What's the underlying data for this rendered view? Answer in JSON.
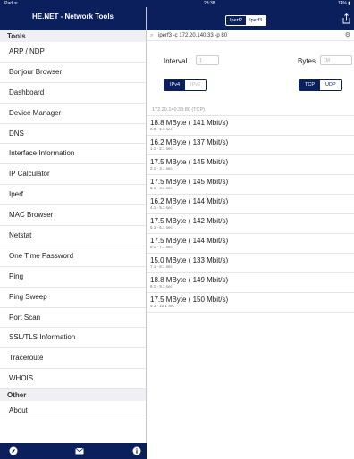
{
  "status_bar": {
    "carrier": "iPad ᯤ",
    "time": "23:38",
    "battery": "74% ▮"
  },
  "sidebar": {
    "title": "HE.NET - Network Tools",
    "sections": [
      {
        "header": "Tools",
        "items": [
          "ARP / NDP",
          "Bonjour Browser",
          "Dashboard",
          "Device Manager",
          "DNS",
          "Interface Information",
          "IP Calculator",
          "Iperf",
          "MAC Browser",
          "Netstat",
          "One Time Password",
          "Ping",
          "Ping Sweep",
          "Port Scan",
          "SSL/TLS Information",
          "Traceroute",
          "WHOIS"
        ]
      },
      {
        "header": "Other",
        "items": [
          "About"
        ]
      }
    ],
    "footer_icons": [
      "compass-icon",
      "mail-icon",
      "info-icon"
    ]
  },
  "main": {
    "segments": [
      "Iperf2",
      "Iperf3"
    ],
    "active_segment": "Iperf3",
    "command": "iperf3 -c 172.20.140.33 -p 80",
    "interval_label": "Interval",
    "interval_placeholder": "1",
    "bytes_label": "Bytes",
    "bytes_placeholder": "1M",
    "ip_options": [
      "IPv4",
      "IPv6"
    ],
    "ip_selected": "IPv4",
    "proto_options": [
      "TCP",
      "UDP"
    ],
    "proto_selected": "TCP",
    "target": "172.20.140.33:80 (TCP)",
    "results": [
      {
        "value": "18.8 MByte ( 141 Mbit/s)",
        "range": "0.0 - 1.1 sec"
      },
      {
        "value": "16.2 MByte ( 137 Mbit/s)",
        "range": "1.1 - 2.1 sec"
      },
      {
        "value": "17.5 MByte ( 145 Mbit/s)",
        "range": "2.1 - 3.1 sec"
      },
      {
        "value": "17.5 MByte ( 145 Mbit/s)",
        "range": "3.1 - 4.1 sec"
      },
      {
        "value": "16.2 MByte ( 144 Mbit/s)",
        "range": "4.1 - 5.1 sec"
      },
      {
        "value": "17.5 MByte ( 142 Mbit/s)",
        "range": "5.1 - 6.1 sec"
      },
      {
        "value": "17.5 MByte ( 144 Mbit/s)",
        "range": "6.1 - 7.1 sec"
      },
      {
        "value": "15.0 MByte ( 133 Mbit/s)",
        "range": "7.1 - 8.1 sec"
      },
      {
        "value": "18.8 MByte ( 149 Mbit/s)",
        "range": "8.1 - 9.1 sec"
      },
      {
        "value": "17.5 MByte ( 150 Mbit/s)",
        "range": "9.1 - 10.1 sec"
      }
    ]
  },
  "colors": {
    "brand": "#0a1f5c",
    "separator": "#e4e4e8"
  }
}
